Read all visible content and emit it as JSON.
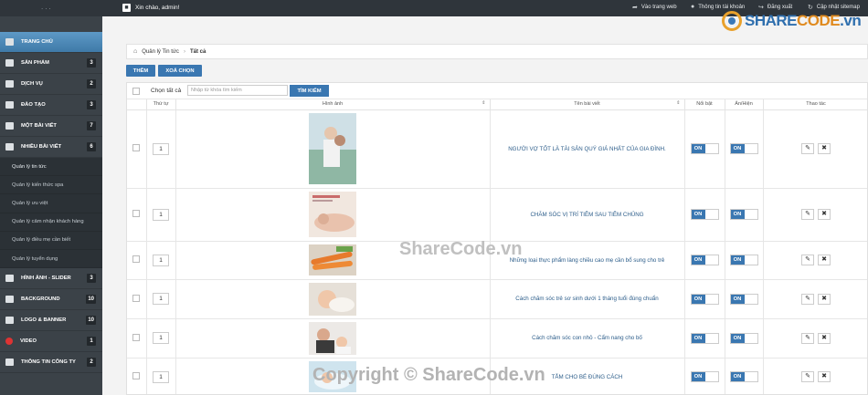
{
  "topbar": {
    "dots": "...",
    "greeting": "Xin chào, admin!",
    "links": [
      "Vào trang web",
      "Thông tin tài khoản",
      "Đăng xuất",
      "Cập nhật sitemap"
    ]
  },
  "sidebar": {
    "items": [
      {
        "label": "TRANG CHỦ",
        "badge": ""
      },
      {
        "label": "SẢN PHẨM",
        "badge": "3"
      },
      {
        "label": "DỊCH VỤ",
        "badge": "2"
      },
      {
        "label": "ĐÀO TẠO",
        "badge": "3"
      },
      {
        "label": "MỘT BÀI VIẾT",
        "badge": "7"
      },
      {
        "label": "NHIỀU BÀI VIẾT",
        "badge": "6"
      }
    ],
    "subitems": [
      "Quản lý tin tức",
      "Quản lý kiến thức spa",
      "Quản lý ưu việt",
      "Quản lý cảm nhận khách hàng",
      "Quản lý điều mẹ cần biết",
      "Quản lý tuyển dụng"
    ],
    "items2": [
      {
        "label": "HÌNH ẢNH - SLIDER",
        "badge": "3"
      },
      {
        "label": "BACKGROUND",
        "badge": "10"
      },
      {
        "label": "LOGO & BANNER",
        "badge": "10"
      },
      {
        "label": "VIDEO",
        "badge": "1"
      },
      {
        "label": "THÔNG TIN CÔNG TY",
        "badge": "2"
      }
    ]
  },
  "breadcrumb": {
    "parent": "Quản lý Tin tức",
    "current": "Tất cả"
  },
  "buttons": {
    "add": "THÊM",
    "delete": "XOÁ CHỌN"
  },
  "search": {
    "select_all": "Chọn tất cả",
    "placeholder": "Nhập từ khóa tìm kiếm",
    "button": "TÌM KIẾM"
  },
  "table": {
    "headers": {
      "order": "Thứ tự",
      "image": "Hình ảnh",
      "title": "Tên bài viết",
      "featured": "Nổi bật",
      "visible": "Ẩn/Hiện",
      "actions": "Thao tác"
    },
    "toggle_on": "ON",
    "rows": [
      {
        "order": "1",
        "title": "NGƯỜI VỢ TỐT LÀ TÀI SẢN QUÝ GIÁ NHẤT CỦA GIA ĐÌNH."
      },
      {
        "order": "1",
        "title": "CHĂM SÓC VỊ TRÍ TIÊM SAU TIÊM CHỦNG"
      },
      {
        "order": "1",
        "title": "Những loại thực phẩm làng chiều cao mẹ cần bổ sung cho trẻ"
      },
      {
        "order": "1",
        "title": "Cách chăm sóc trẻ sơ sinh dưới 1 tháng tuổi đúng chuẩn"
      },
      {
        "order": "1",
        "title": "Cách chăm sóc con nhỏ - Cẩm nang cho bố"
      },
      {
        "order": "1",
        "title": "TẮM CHO BÉ ĐÚNG CÁCH"
      }
    ]
  },
  "watermarks": {
    "logo_a": "SHARE",
    "logo_b": "CODE",
    "logo_c": ".vn",
    "center": "ShareCode.vn",
    "bottom": "Copyright © ShareCode.vn"
  },
  "colors": {
    "accent": "#3a77b1",
    "sidebar": "#3b4248",
    "topbar": "#2f353b"
  }
}
